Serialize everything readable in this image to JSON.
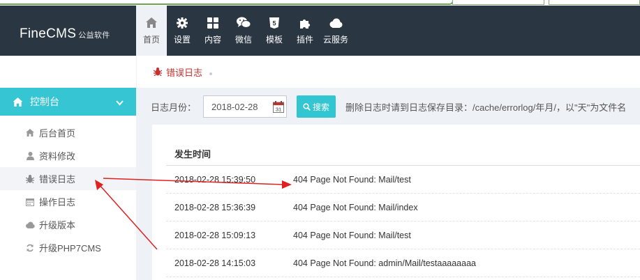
{
  "brand": {
    "name": "FineCMS",
    "sub": "公益软件"
  },
  "nav": [
    {
      "label": "首页",
      "icon": "home-icon",
      "active": true
    },
    {
      "label": "设置",
      "icon": "gear-icon"
    },
    {
      "label": "内容",
      "icon": "grid-icon"
    },
    {
      "label": "微信",
      "icon": "wechat-icon"
    },
    {
      "label": "模板",
      "icon": "html5-icon"
    },
    {
      "label": "插件",
      "icon": "puzzle-icon"
    },
    {
      "label": "云服务",
      "icon": "cloud-icon"
    }
  ],
  "sidebar": {
    "section": "控制台",
    "items": [
      {
        "label": "后台首页",
        "icon": "home-icon"
      },
      {
        "label": "资料修改",
        "icon": "user-icon"
      },
      {
        "label": "错误日志",
        "icon": "bug-icon",
        "active": true
      },
      {
        "label": "操作日志",
        "icon": "calendar-icon"
      },
      {
        "label": "升级版本",
        "icon": "cloud-icon"
      },
      {
        "label": "升级PHP7CMS",
        "icon": "refresh-icon"
      }
    ]
  },
  "breadcrumb": {
    "label": "错误日志"
  },
  "filter": {
    "label": "日志月份：",
    "date_value": "2018-02-28",
    "search_label": "搜索",
    "hint": "删除日志时请到日志保存目录：/cache/errorlog/年月/，以\"天\"为文件名"
  },
  "table": {
    "header": "发生时间",
    "rows": [
      {
        "time": "2018-02-28 15:39:50",
        "message": "404 Page Not Found: Mail/test"
      },
      {
        "time": "2018-02-28 15:36:39",
        "message": "404 Page Not Found: Mail/index"
      },
      {
        "time": "2018-02-28 15:09:13",
        "message": "404 Page Not Found: Mail/test"
      },
      {
        "time": "2018-02-28 14:15:03",
        "message": "404 Page Not Found: admin/Mail/testaaaaaaaa"
      }
    ]
  },
  "colors": {
    "header_bg": "#2b3643",
    "accent": "#36c6d3",
    "annotation": "#e02020",
    "crumb": "#c9302c"
  }
}
